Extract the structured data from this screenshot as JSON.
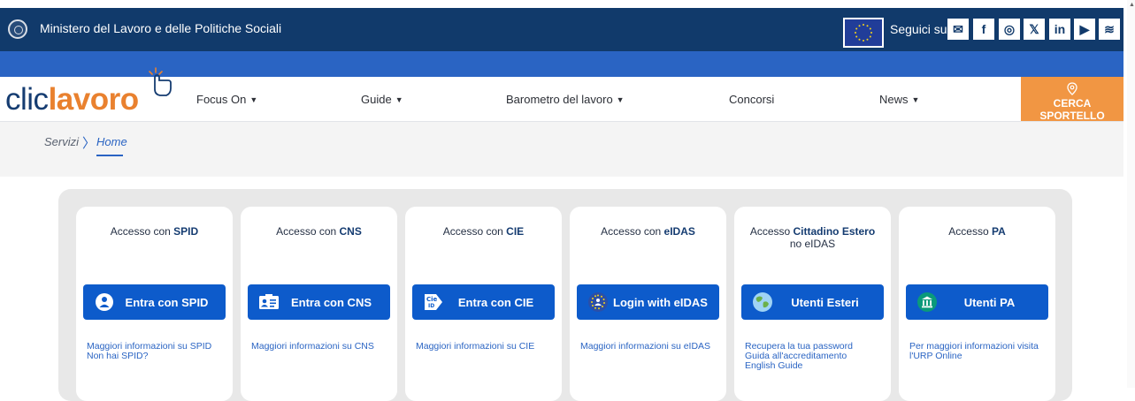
{
  "header": {
    "ministry": "Ministero del Lavoro e delle Politiche Sociali",
    "follow_label": "Seguici su:",
    "social": [
      {
        "name": "mail-icon",
        "glyph": "✉"
      },
      {
        "name": "facebook-icon",
        "glyph": "f"
      },
      {
        "name": "instagram-icon",
        "glyph": "◎"
      },
      {
        "name": "x-icon",
        "glyph": "𝕏"
      },
      {
        "name": "linkedin-icon",
        "glyph": "in"
      },
      {
        "name": "youtube-icon",
        "glyph": "▶"
      },
      {
        "name": "rss-icon",
        "glyph": "≋"
      }
    ]
  },
  "nav": {
    "logo_part1": "clic",
    "logo_part2": "lavoro",
    "items": [
      "Focus On",
      "Guide",
      "Barometro del lavoro",
      "Concorsi",
      "News"
    ],
    "cta": "CERCA SPORTELLO"
  },
  "breadcrumb": {
    "servizi": "Servizi",
    "separator": "〉",
    "home": "Home"
  },
  "cards": [
    {
      "title_pre": "Accesso con ",
      "title_bold": "SPID",
      "title_line2": "",
      "button": "Entra con SPID",
      "links": [
        "Maggiori informazioni su SPID",
        "Non hai SPID?"
      ]
    },
    {
      "title_pre": "Accesso con ",
      "title_bold": "CNS",
      "title_line2": "",
      "button": "Entra con CNS",
      "links": [
        "Maggiori informazioni su CNS"
      ]
    },
    {
      "title_pre": "Accesso con ",
      "title_bold": "CIE",
      "title_line2": "",
      "button": "Entra con CIE",
      "links": [
        "Maggiori informazioni su CIE"
      ]
    },
    {
      "title_pre": "Accesso con ",
      "title_bold": "eIDAS",
      "title_line2": "",
      "button": "Login with eIDAS",
      "links": [
        "Maggiori informazioni su eIDAS"
      ]
    },
    {
      "title_pre": "Accesso ",
      "title_bold": "Cittadino Estero",
      "title_line2": "no eIDAS",
      "button": "Utenti Esteri",
      "links": [
        "Recupera la tua password",
        "Guida all'accreditamento",
        "English Guide"
      ]
    },
    {
      "title_pre": "Accesso ",
      "title_bold": "PA",
      "title_line2": "",
      "button": "Utenti PA",
      "links": [
        "Per maggiori informazioni visita",
        "l'URP Online"
      ]
    }
  ],
  "colors": {
    "header_bg": "#113a6b",
    "strip_bg": "#2a64c3",
    "button_bg": "#0d5bcb",
    "cta_bg": "#f19643",
    "logo_orange": "#e9812f"
  }
}
